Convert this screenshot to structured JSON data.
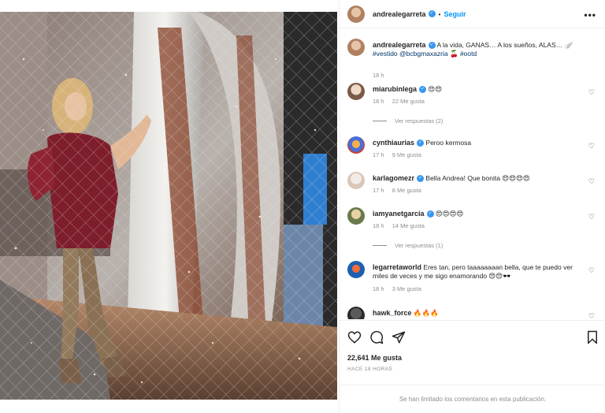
{
  "post": {
    "author": "andrealegarreta",
    "follow_label": "Seguir",
    "more_label": "•••"
  },
  "caption": {
    "user": "andrealegarreta",
    "text_line1": "A la vida, GANAS… A los sueños, ALAS… 🪽",
    "hashtag_vestido": "#vestido",
    "mention": "@bcbgmaxazria",
    "hashtag_ootd": "#ootd",
    "emoji": "🍒",
    "time": "18 h"
  },
  "comments": [
    {
      "user": "miarubinlega",
      "text": "😍😍",
      "time": "18 h",
      "likes": "22 Me gusta",
      "replies": "Ver respuestas (2)"
    },
    {
      "user": "cynthiaurias",
      "text": "Peroo kermosa",
      "time": "17 h",
      "likes": "9 Me gusta"
    },
    {
      "user": "karlagomezr",
      "text": "Bella Andrea! Que bonita 😍😍😍😍",
      "time": "17 h",
      "likes": "8 Me gusta"
    },
    {
      "user": "iamyanetgarcia",
      "text": "😍😍😍😍",
      "time": "18 h",
      "likes": "14 Me gusta",
      "replies": "Ver respuestas (1)"
    },
    {
      "user": "legarretaworld",
      "text": "Eres tan, pero taaaaaaaan bella, que te puedo ver miles de veces y me sigo enamorando 😍😍🕶️",
      "time": "18 h",
      "likes": "3 Me gusta"
    },
    {
      "user": "hawk_force",
      "text": "🔥🔥🔥"
    }
  ],
  "engagement": {
    "likes": "22,641 Me gusta",
    "time_ago": "HACE 18 HORAS"
  },
  "footer": {
    "notice": "Se han limitado los comentarios en esta publicación."
  },
  "icons": {
    "like": "heart-icon",
    "comment": "comment-icon",
    "share": "send-icon",
    "save": "bookmark-icon"
  }
}
